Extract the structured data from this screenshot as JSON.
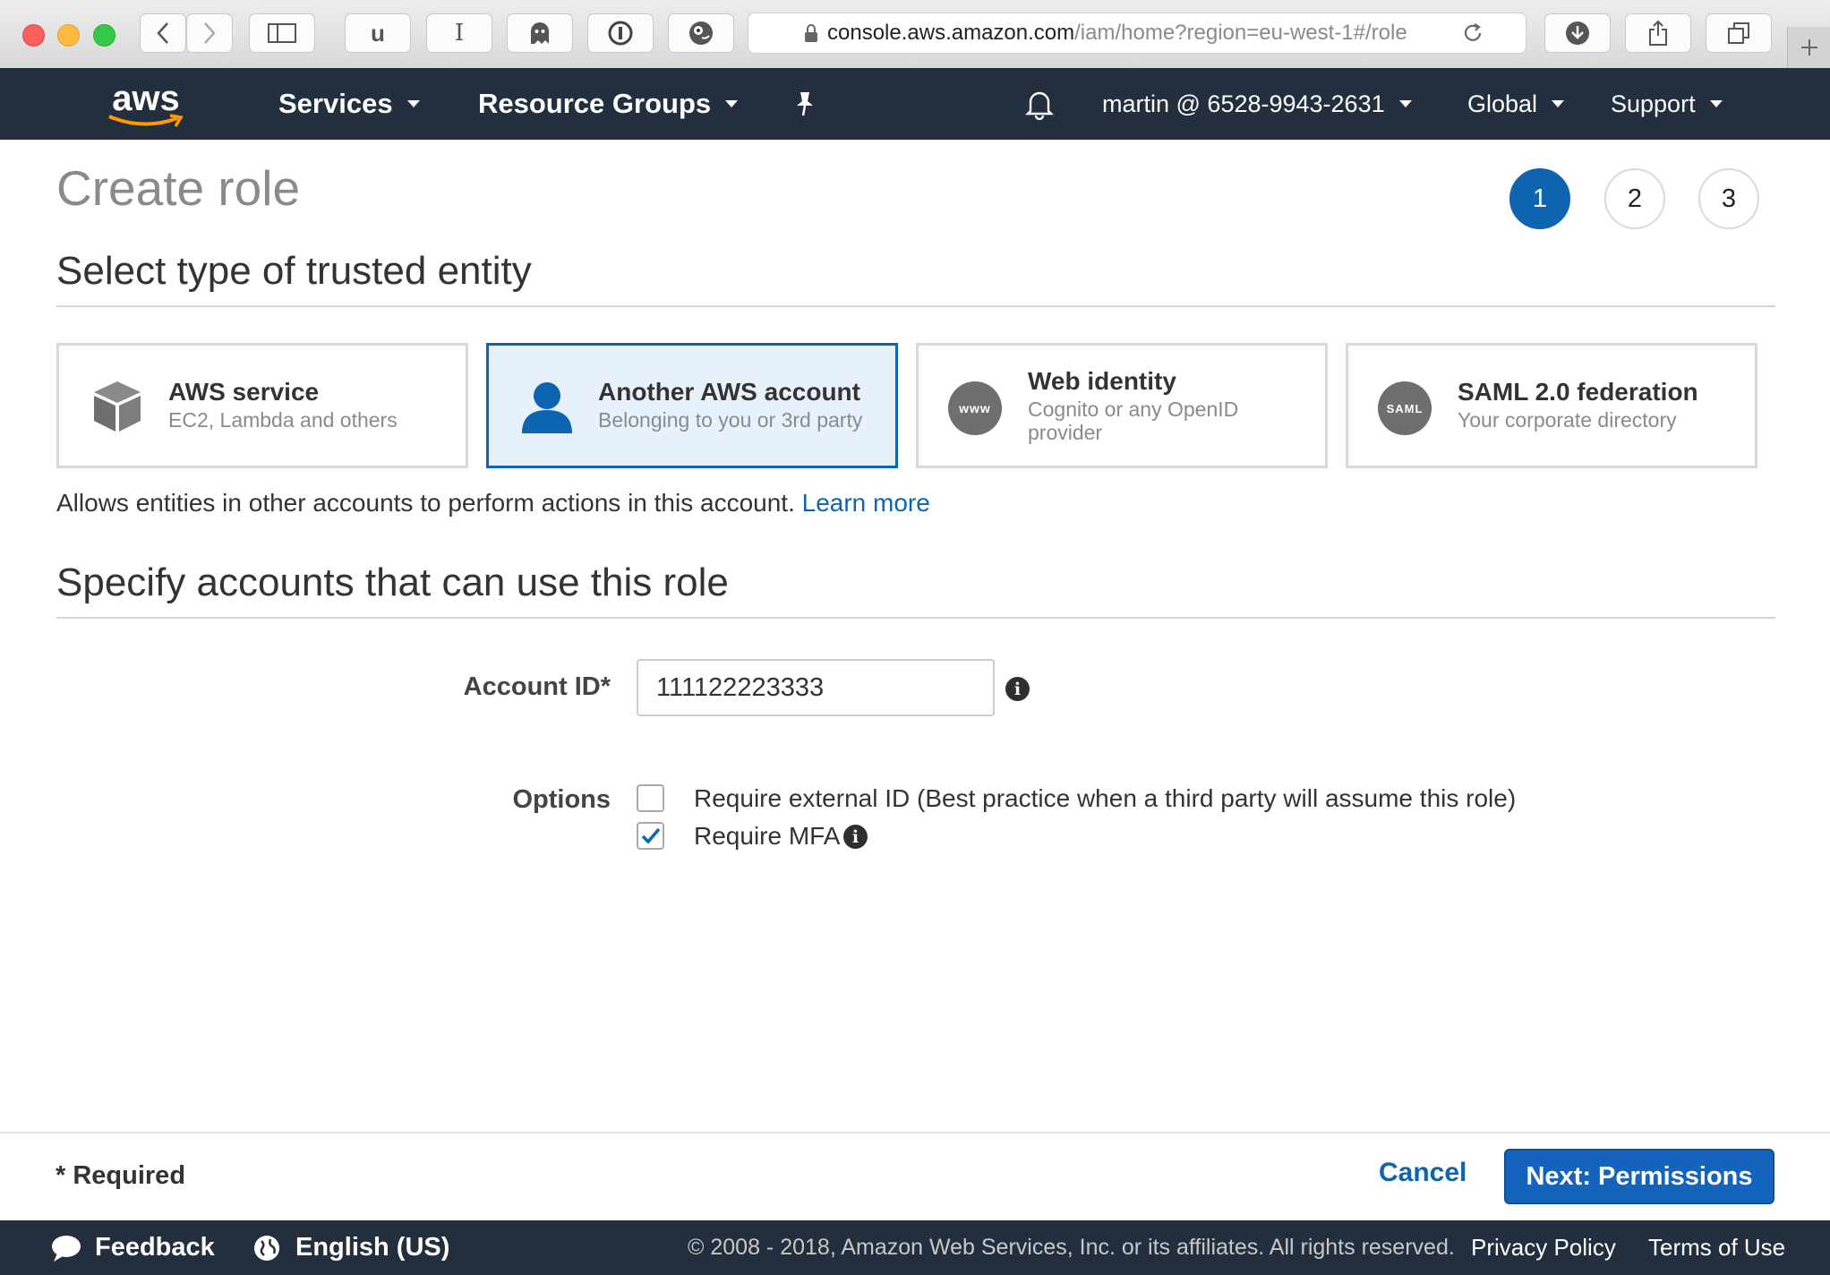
{
  "browser": {
    "url_host": "console.aws.amazon.com",
    "url_path": "/iam/home?region=eu-west-1#/role",
    "ext_buttons": [
      "u",
      "I"
    ]
  },
  "nav": {
    "logo": "aws",
    "services": "Services",
    "resource_groups": "Resource Groups",
    "account": "martin @ 6528-9943-2631",
    "region": "Global",
    "support": "Support"
  },
  "page": {
    "title": "Create role",
    "steps": [
      "1",
      "2",
      "3"
    ],
    "active_step": 1
  },
  "trusted_entity": {
    "heading": "Select type of trusted entity",
    "cards": [
      {
        "title": "AWS service",
        "subtitle": "EC2, Lambda and others",
        "selected": false
      },
      {
        "title": "Another AWS account",
        "subtitle": "Belonging to you or 3rd party",
        "selected": true
      },
      {
        "title": "Web identity",
        "subtitle": "Cognito or any OpenID provider",
        "selected": false,
        "icon_text": "www"
      },
      {
        "title": "SAML 2.0 federation",
        "subtitle": "Your corporate directory",
        "selected": false,
        "icon_text": "SAML"
      }
    ],
    "description": "Allows entities in other accounts to perform actions in this account.",
    "learn_more": "Learn more"
  },
  "accounts": {
    "heading": "Specify accounts that can use this role",
    "account_id_label": "Account ID*",
    "account_id_value": "111122223333",
    "options_label": "Options",
    "options": [
      {
        "label": "Require external ID (Best practice when a third party will assume this role)",
        "checked": false
      },
      {
        "label": "Require MFA",
        "checked": true
      }
    ]
  },
  "footer": {
    "required": "* Required",
    "cancel": "Cancel",
    "next": "Next: Permissions"
  },
  "bottombar": {
    "feedback": "Feedback",
    "language": "English (US)",
    "copyright": "© 2008 - 2018, Amazon Web Services, Inc. or its affiliates. All rights reserved.",
    "privacy": "Privacy Policy",
    "terms": "Terms of Use"
  },
  "colors": {
    "nav_bg": "#232f3e",
    "accent_blue": "#0f64b2",
    "selected_card_bg": "#e7f1fb",
    "primary_button": "#1464bd"
  }
}
